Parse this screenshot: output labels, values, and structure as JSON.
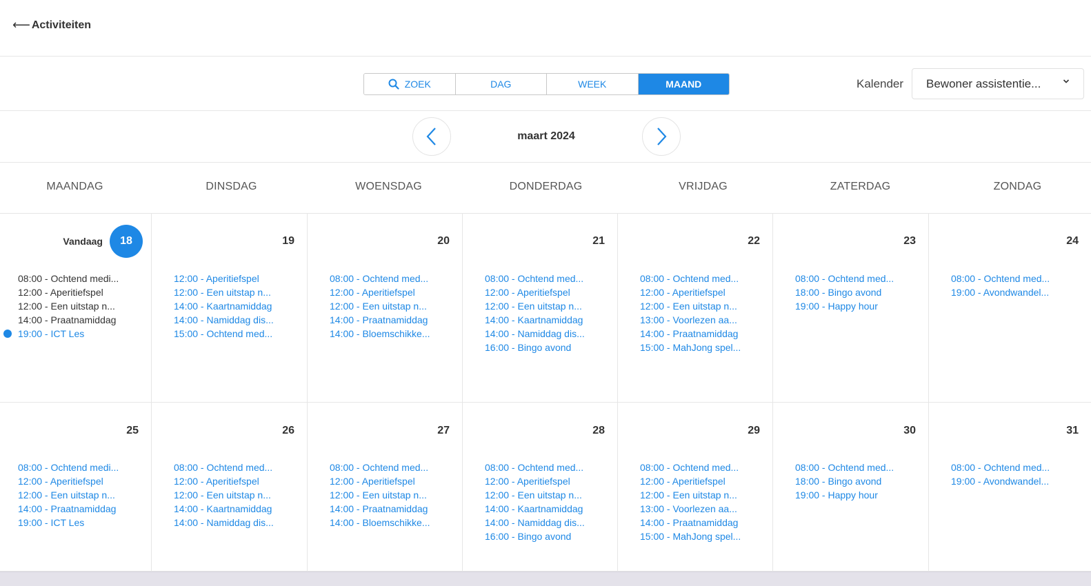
{
  "header": {
    "back_arrow": "⟵",
    "back_label": "Activiteiten"
  },
  "toolbar": {
    "search_label": "ZOEK",
    "day_label": "DAG",
    "week_label": "WEEK",
    "month_label": "MAAND",
    "active_view": "MAAND",
    "calendar_label": "Kalender",
    "calendar_value": "Bewoner assistentie..."
  },
  "month": {
    "title": "maart 2024"
  },
  "weekdays": [
    "MAANDAG",
    "DINSDAG",
    "WOENSDAG",
    "DONDERDAG",
    "VRIJDAG",
    "ZATERDAG",
    "ZONDAG"
  ],
  "today_label": "Vandaag",
  "colors": {
    "accent": "#1e88e5",
    "text": "#333333",
    "border": "#e6e6e6"
  },
  "weeks": [
    [
      {
        "day": "18",
        "today": true,
        "events": [
          {
            "text": "08:00 - Ochtend medi...",
            "past": true
          },
          {
            "text": "12:00 - Aperitiefspel",
            "past": true
          },
          {
            "text": "12:00 - Een uitstap n...",
            "past": true
          },
          {
            "text": "14:00 - Praatnamiddag",
            "past": true
          },
          {
            "text": "19:00 - ICT Les",
            "past": false,
            "current": true
          }
        ]
      },
      {
        "day": "19",
        "events": [
          {
            "text": "12:00 - Aperitiefspel"
          },
          {
            "text": "12:00 - Een uitstap n..."
          },
          {
            "text": "14:00 - Kaartnamiddag"
          },
          {
            "text": "14:00 - Namiddag dis..."
          },
          {
            "text": "15:00 - Ochtend med..."
          }
        ]
      },
      {
        "day": "20",
        "events": [
          {
            "text": "08:00 - Ochtend med..."
          },
          {
            "text": "12:00 - Aperitiefspel"
          },
          {
            "text": "12:00 - Een uitstap n..."
          },
          {
            "text": "14:00 - Praatnamiddag"
          },
          {
            "text": "14:00 - Bloemschikke..."
          }
        ]
      },
      {
        "day": "21",
        "events": [
          {
            "text": "08:00 - Ochtend med..."
          },
          {
            "text": "12:00 - Aperitiefspel"
          },
          {
            "text": "12:00 - Een uitstap n..."
          },
          {
            "text": "14:00 - Kaartnamiddag"
          },
          {
            "text": "14:00 - Namiddag dis..."
          },
          {
            "text": "16:00 - Bingo avond"
          }
        ]
      },
      {
        "day": "22",
        "events": [
          {
            "text": "08:00 - Ochtend med..."
          },
          {
            "text": "12:00 - Aperitiefspel"
          },
          {
            "text": "12:00 - Een uitstap n..."
          },
          {
            "text": "13:00 - Voorlezen aa..."
          },
          {
            "text": "14:00 - Praatnamiddag"
          },
          {
            "text": "15:00 - MahJong spel..."
          }
        ]
      },
      {
        "day": "23",
        "events": [
          {
            "text": "08:00 - Ochtend med..."
          },
          {
            "text": "18:00 - Bingo avond"
          },
          {
            "text": "19:00 - Happy hour"
          }
        ]
      },
      {
        "day": "24",
        "events": [
          {
            "text": "08:00 - Ochtend med..."
          },
          {
            "text": "19:00 - Avondwandel..."
          }
        ]
      }
    ],
    [
      {
        "day": "25",
        "events": [
          {
            "text": "08:00 - Ochtend medi..."
          },
          {
            "text": "12:00 - Aperitiefspel"
          },
          {
            "text": "12:00 - Een uitstap n..."
          },
          {
            "text": "14:00 - Praatnamiddag"
          },
          {
            "text": "19:00 - ICT Les"
          }
        ]
      },
      {
        "day": "26",
        "events": [
          {
            "text": "08:00 - Ochtend med..."
          },
          {
            "text": "12:00 - Aperitiefspel"
          },
          {
            "text": "12:00 - Een uitstap n..."
          },
          {
            "text": "14:00 - Kaartnamiddag"
          },
          {
            "text": "14:00 - Namiddag dis..."
          }
        ]
      },
      {
        "day": "27",
        "events": [
          {
            "text": "08:00 - Ochtend med..."
          },
          {
            "text": "12:00 - Aperitiefspel"
          },
          {
            "text": "12:00 - Een uitstap n..."
          },
          {
            "text": "14:00 - Praatnamiddag"
          },
          {
            "text": "14:00 - Bloemschikke..."
          }
        ]
      },
      {
        "day": "28",
        "events": [
          {
            "text": "08:00 - Ochtend med..."
          },
          {
            "text": "12:00 - Aperitiefspel"
          },
          {
            "text": "12:00 - Een uitstap n..."
          },
          {
            "text": "14:00 - Kaartnamiddag"
          },
          {
            "text": "14:00 - Namiddag dis..."
          },
          {
            "text": "16:00 - Bingo avond"
          }
        ]
      },
      {
        "day": "29",
        "events": [
          {
            "text": "08:00 - Ochtend med..."
          },
          {
            "text": "12:00 - Aperitiefspel"
          },
          {
            "text": "12:00 - Een uitstap n..."
          },
          {
            "text": "13:00 - Voorlezen aa..."
          },
          {
            "text": "14:00 - Praatnamiddag"
          },
          {
            "text": "15:00 - MahJong spel..."
          }
        ]
      },
      {
        "day": "30",
        "events": [
          {
            "text": "08:00 - Ochtend med..."
          },
          {
            "text": "18:00 - Bingo avond"
          },
          {
            "text": "19:00 - Happy hour"
          }
        ]
      },
      {
        "day": "31",
        "events": [
          {
            "text": "08:00 - Ochtend med..."
          },
          {
            "text": "19:00 - Avondwandel..."
          }
        ]
      }
    ]
  ]
}
